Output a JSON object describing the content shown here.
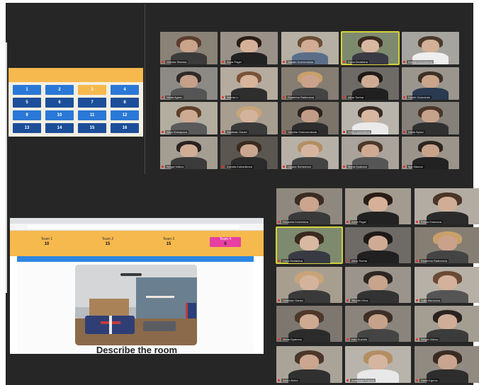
{
  "colors": {
    "zoom_bg": "#262626",
    "sheet_orange": "#f6b94d",
    "key_blue": "#2a78d7",
    "key_dark": "#1d4e9a",
    "highlight": "#d4d23a",
    "banner_blue": "#2d86e0",
    "points_pink": "#e640a2"
  },
  "game_board": {
    "keys": [
      "1",
      "2",
      "3",
      "4",
      "5",
      "6",
      "7",
      "8",
      "9",
      "10",
      "11",
      "12",
      "13",
      "14",
      "15",
      "16"
    ]
  },
  "quiz": {
    "teams": [
      {
        "name": "Team 1",
        "score": "10"
      },
      {
        "name": "Team 2",
        "score": "15"
      },
      {
        "name": "Team 3",
        "score": "15"
      },
      {
        "name": "Team 4",
        "score": "0"
      }
    ],
    "question": "Describe the room"
  },
  "gallery_top": [
    {
      "name": "Victoria Sharma",
      "skin": "#c9a38a",
      "hair": "#5a3d2e",
      "shirt": "#3b3b3b",
      "bg": "#8a8276"
    },
    {
      "name": "Anna Pagel",
      "skin": "#d6b199",
      "hair": "#2a1d16",
      "shirt": "#222222",
      "bg": "#9a9288"
    },
    {
      "name": "Natalia Koshevskaia",
      "skin": "#d1ab93",
      "hair": "#6b4d36",
      "shirt": "#5a6e8a",
      "bg": "#b6b0a4"
    },
    {
      "name": "Daria Deriabina",
      "skin": "#d9b8a2",
      "hair": "#3a2a20",
      "shirt": "#3a3a44",
      "bg": "#7e8a6e"
    },
    {
      "name": "Kamila Kuznetsova",
      "skin": "#d3b097",
      "hair": "#4a3a2c",
      "shirt": "#eeeeee",
      "bg": "#a6a49e"
    },
    {
      "name": "Nikita Ageev",
      "skin": "#c7a08a",
      "hair": "#2e2a28",
      "shirt": "#555555",
      "bg": "#8d8a86"
    },
    {
      "name": "Valeria Li",
      "skin": "#d7b59d",
      "hair": "#7a5236",
      "shirt": "#2e2e2e",
      "bg": "#b5ab9f"
    },
    {
      "name": "Ekaterina Radionova",
      "skin": "#caa28b",
      "hair": "#c9a06a",
      "shirt": "#444444",
      "bg": "#867e72"
    },
    {
      "name": "Alina Tiurina",
      "skin": "#d0ab94",
      "hair": "#1f1a18",
      "shirt": "#202020",
      "bg": "#6e6a66"
    },
    {
      "name": "Dmitrii Goloviznin",
      "skin": "#c9a58c",
      "hair": "#3d3026",
      "shirt": "#2a3a50",
      "bg": "#9a958d"
    },
    {
      "name": "Alisa Sharapova",
      "skin": "#cfaa92",
      "hair": "#5e3f2a",
      "shirt": "#5a5a5a",
      "bg": "#b3ad9f"
    },
    {
      "name": "Vladislav Ganev",
      "skin": "#d4b39c",
      "hair": "#c8a47a",
      "shirt": "#3a3a3a",
      "bg": "#a79e90"
    },
    {
      "name": "Viktoriia Gaivoronskaia",
      "skin": "#c29c86",
      "hair": "#2c2220",
      "shirt": "#2d2d2d",
      "bg": "#7c7468"
    },
    {
      "name": "Sofia Lavrentieva",
      "skin": "#d8b7a0",
      "hair": "#3a2b22",
      "shirt": "#eaeaea",
      "bg": "#b8b4ac"
    },
    {
      "name": "Nikita Bykov",
      "skin": "#c7a28b",
      "hair": "#4a3628",
      "shirt": "#303030",
      "bg": "#85807a"
    },
    {
      "name": "Sergei Volkov",
      "skin": "#d0ad95",
      "hair": "#2a2220",
      "shirt": "#3b3b3b",
      "bg": "#a49d92"
    },
    {
      "name": "Kseniia Kolesnikova",
      "skin": "#c9a68f",
      "hair": "#3b2a20",
      "shirt": "#2b2b2b",
      "bg": "#5b5650"
    },
    {
      "name": "Ulyana Semenova",
      "skin": "#d6b5a0",
      "hair": "#b38e64",
      "shirt": "#444444",
      "bg": "#b7b0a6"
    },
    {
      "name": "Maria Dyakova",
      "skin": "#cfaa92",
      "hair": "#4d382a",
      "shirt": "#555555",
      "bg": "#a9a39b"
    },
    {
      "name": "Ilya Sidorov",
      "skin": "#c8a28a",
      "hair": "#2b2420",
      "shirt": "#222222",
      "bg": "#9b948a"
    }
  ],
  "gallery_bottom": [
    {
      "name": "Elizaveta Kosheleva",
      "skin": "#cba58d",
      "hair": "#3a2c22",
      "shirt": "#3a3a3a",
      "bg": "#8f887e"
    },
    {
      "name": "Anna Pagel",
      "skin": "#d6b199",
      "hair": "#2a1d16",
      "shirt": "#222222",
      "bg": "#a39b90"
    },
    {
      "name": "Polina Krasnova",
      "skin": "#d1ad96",
      "hair": "#4a3526",
      "shirt": "#2b2b2b",
      "bg": "#b2aca2"
    },
    {
      "name": "Daria Deriabina",
      "skin": "#d9b8a2",
      "hair": "#3a2a20",
      "shirt": "#3a3a44",
      "bg": "#7e8a6e"
    },
    {
      "name": "Alina Tiurina",
      "skin": "#d0ab94",
      "hair": "#1f1a18",
      "shirt": "#202020",
      "bg": "#6e6a66"
    },
    {
      "name": "Ekaterina Radionova",
      "skin": "#caa28b",
      "hair": "#c9a06a",
      "shirt": "#444444",
      "bg": "#867e72"
    },
    {
      "name": "Vladislav Ganev",
      "skin": "#d4b39c",
      "hair": "#c8a47a",
      "shirt": "#3a3a3a",
      "bg": "#a79e90"
    },
    {
      "name": "Timofei Orlov",
      "skin": "#c9a48c",
      "hair": "#2e2622",
      "shirt": "#333333",
      "bg": "#9a948c"
    },
    {
      "name": "Yulia Morozova",
      "skin": "#d3b19b",
      "hair": "#6a4a34",
      "shirt": "#555555",
      "bg": "#b6b0a6"
    },
    {
      "name": "Maria Dyakova",
      "skin": "#cfaa92",
      "hair": "#4d382a",
      "shirt": "#2b2b2b",
      "bg": "#7d776f"
    },
    {
      "name": "Ivan Kuzmin",
      "skin": "#c7a28b",
      "hair": "#3e2f26",
      "shirt": "#444444",
      "bg": "#8a847c"
    },
    {
      "name": "Sergei Volkov",
      "skin": "#d0ad95",
      "hair": "#2a2220",
      "shirt": "#3b3b3b",
      "bg": "#a49d92"
    },
    {
      "name": "Artem Belov",
      "skin": "#cba68e",
      "hair": "#4b3729",
      "shirt": "#303030",
      "bg": "#aaa398"
    },
    {
      "name": "Anastasia Popova",
      "skin": "#d6b5a0",
      "hair": "#b38e64",
      "shirt": "#e8e8e8",
      "bg": "#b9b4ab"
    },
    {
      "name": "Daniil Egorov",
      "skin": "#caa58e",
      "hair": "#3a2b22",
      "shirt": "#2d2d2d",
      "bg": "#918a80"
    }
  ]
}
